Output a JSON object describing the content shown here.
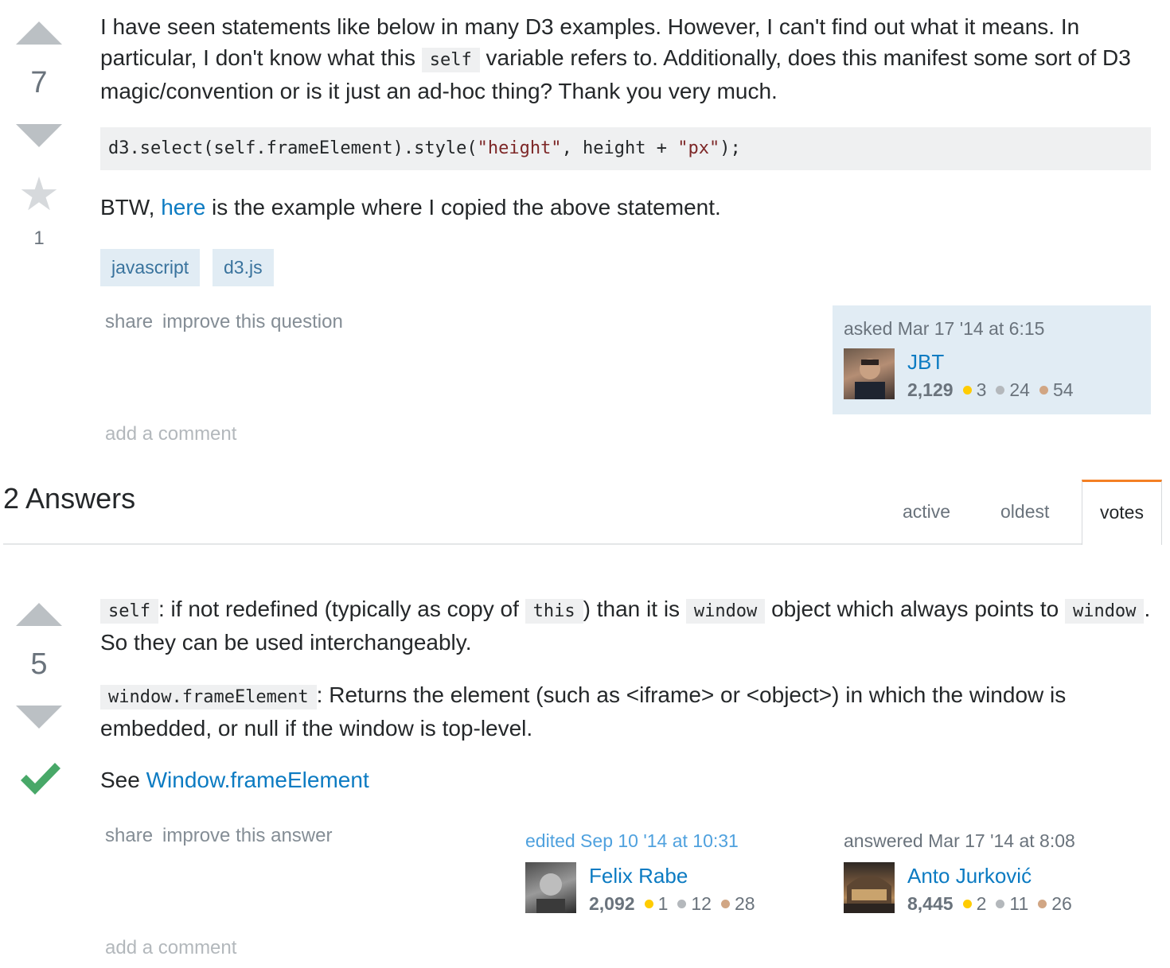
{
  "question": {
    "votes": "7",
    "favorites": "1",
    "para1": {
      "t1": "I have seen statements like below in many D3 examples. However, I can't find out what it means. In particular, I don't know what this ",
      "code": "self",
      "t2": " variable refers to. Additionally, does this manifest some sort of D3 magic/convention or is it just an ad-hoc thing? Thank you very much."
    },
    "code_block": {
      "pre": "d3.select(self.frameElement).style(",
      "s1": "\"height\"",
      "mid": ", height + ",
      "s2": "\"px\"",
      "post": ");"
    },
    "para2": {
      "t1": "BTW, ",
      "link": "here",
      "t2": " is the example where I copied the above statement."
    },
    "tags": [
      "javascript",
      "d3.js"
    ],
    "menu": {
      "share": "share",
      "improve": "improve this question"
    },
    "asked": {
      "time": "asked Mar 17 '14 at 6:15",
      "user": "JBT",
      "rep": "2,129",
      "gold": "3",
      "silver": "24",
      "bronze": "54"
    },
    "add_comment": "add a comment"
  },
  "answers_header": {
    "title": "2 Answers",
    "tabs": [
      "active",
      "oldest",
      "votes"
    ],
    "active_tab": "votes"
  },
  "answer": {
    "votes": "5",
    "para1": {
      "c1": "self",
      "t1": ": if not redefined (typically as copy of ",
      "c2": "this",
      "t2": ") than it is ",
      "c3": "window",
      "t3": " object which always points to ",
      "c4": "window",
      "t4": ". So they can be used interchangeably."
    },
    "para2": {
      "c1": "window.frameElement",
      "t1": ": Returns the element (such as <iframe> or <object>) in which the window is embedded, or null if the window is top-level."
    },
    "para3": {
      "t1": "See ",
      "link": "Window.frameElement"
    },
    "menu": {
      "share": "share",
      "improve": "improve this answer"
    },
    "edited": {
      "time": "edited Sep 10 '14 at 10:31",
      "user": "Felix Rabe",
      "rep": "2,092",
      "gold": "1",
      "silver": "12",
      "bronze": "28"
    },
    "answered": {
      "time": "answered Mar 17 '14 at 8:08",
      "user": "Anto Jurković",
      "rep": "8,445",
      "gold": "2",
      "silver": "11",
      "bronze": "26"
    },
    "add_comment": "add a comment"
  },
  "colors": {
    "gold": "#ffcc01",
    "silver": "#b4b8bc",
    "bronze": "#d1a684",
    "accepted": "#48a868",
    "tab_accent": "#f48024",
    "link": "#0c7bc2"
  }
}
